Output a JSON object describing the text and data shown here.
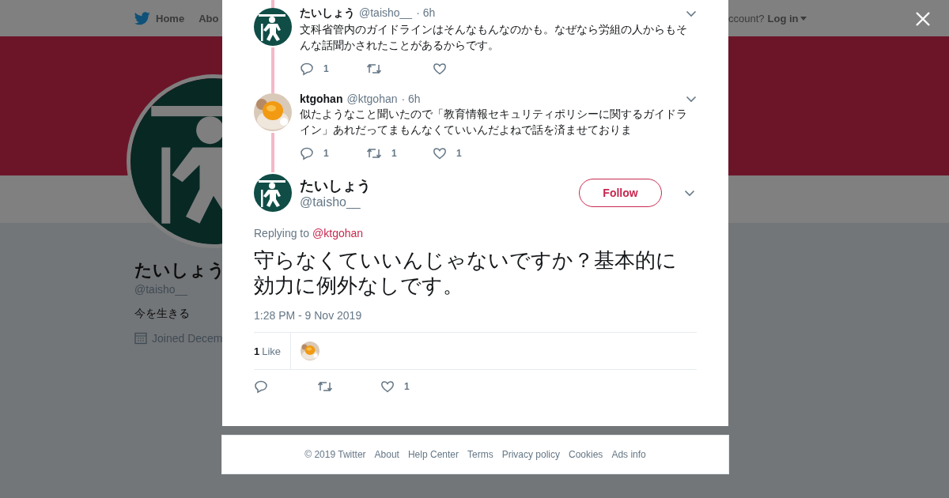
{
  "topbar": {
    "nav": [
      {
        "label": "Home",
        "kind": "home"
      },
      {
        "label": "Abo",
        "kind": "plain"
      }
    ],
    "account_prompt": "ccount?",
    "login": "Log in"
  },
  "profile": {
    "name": "たいしょう",
    "handle": "@taisho__",
    "bio": "今を生きる",
    "joined": "Joined Decem"
  },
  "thread": [
    {
      "name": "たいしょう",
      "handle": "@taisho__",
      "time": "· 6h",
      "avatar": {
        "kind": "figure"
      },
      "text": "文科省管内のガイドラインはそんなもんなのかも。なぜなら労組の人からもそんな話聞かされたことがあるからです。",
      "replies": "1"
    },
    {
      "name": "ktgohan",
      "handle": "@ktgohan",
      "time": "· 6h",
      "text": "似たようなこと聞いたので「教育情報セキュリティポリシーに関するガイドライン」あれだってまもんなくていいんだよねで話を済ませておりま",
      "replies": "1",
      "retweets": "1",
      "likes": "1"
    }
  ],
  "focus": {
    "name": "たいしょう",
    "handle": "@taisho__",
    "avatar": {
      "kind": "figure"
    },
    "follow": "Follow",
    "replying_prefix": "Replying to",
    "reply_to": "@ktgohan",
    "text": "守らなくていいんじゃないですか？基本的に効力に例外なしです。",
    "timestamp": "1:28 PM - 9 Nov 2019",
    "like_count": "1",
    "like_label": "Like",
    "likes": "1"
  },
  "footer": [
    "© 2019 Twitter",
    "About",
    "Help Center",
    "Terms",
    "Privacy policy",
    "Cookies",
    "Ads info"
  ]
}
